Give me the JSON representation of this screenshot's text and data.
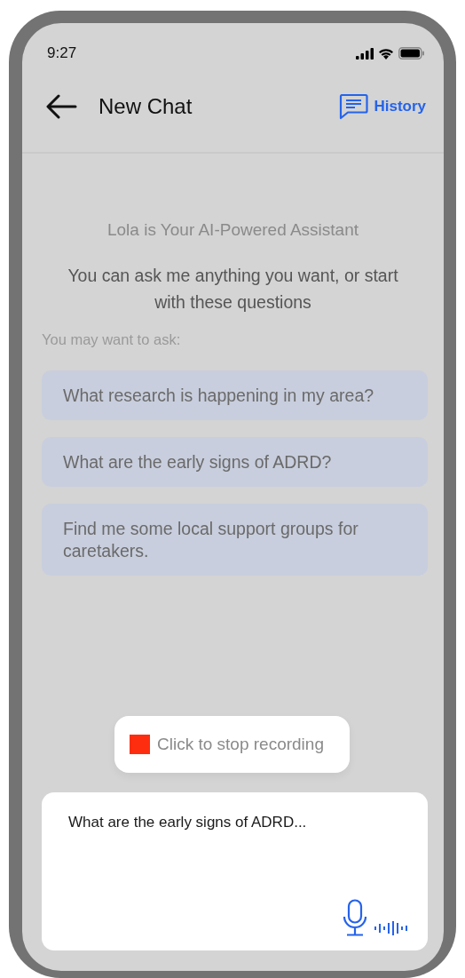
{
  "status_bar": {
    "time": "9:27"
  },
  "header": {
    "title": "New Chat",
    "history_label": "History"
  },
  "intro": {
    "title": "Lola is Your AI-Powered Assistant",
    "subtitle": "You can ask me anything you want, or start with these questions"
  },
  "suggestions": {
    "label": "You may want to ask:",
    "items": [
      "What research is happening in my area?",
      "What are the early signs of ADRD?",
      "Find me some local support groups for caretakers."
    ]
  },
  "recording": {
    "label": "Click to stop recording",
    "color": "#ff2d0f"
  },
  "input": {
    "value": "What are the early signs of ADRD..."
  }
}
